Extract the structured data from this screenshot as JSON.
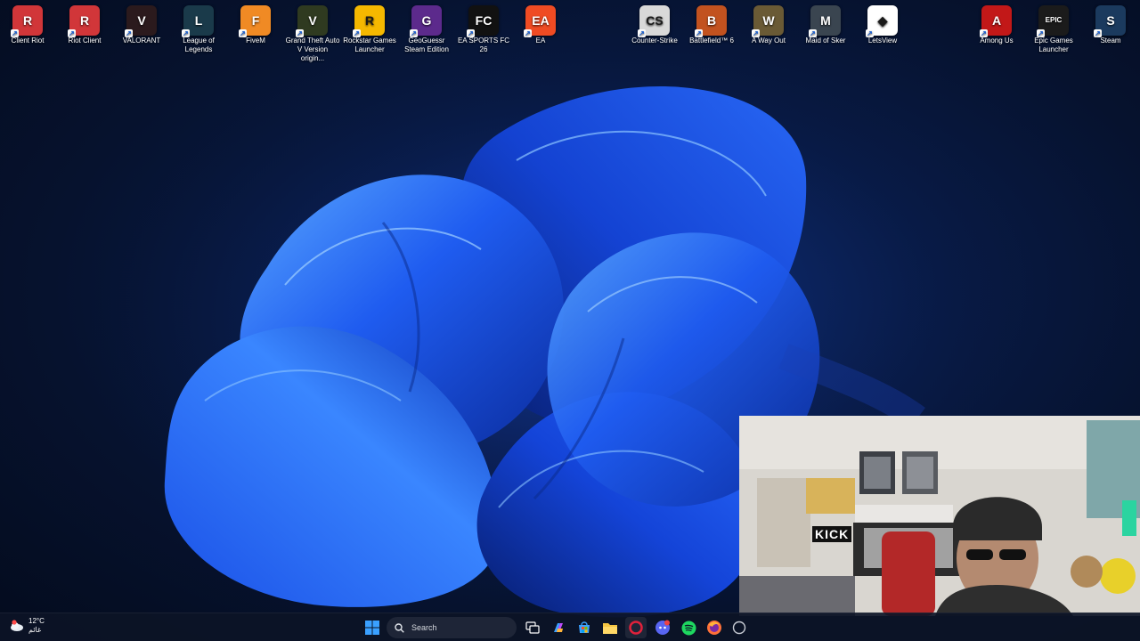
{
  "desktop": {
    "icons": [
      {
        "label": "Client Riot",
        "icon": "riot-client-icon",
        "color": "#d13639",
        "glyph": "R"
      },
      {
        "label": "Riot Client",
        "icon": "riot-client-icon",
        "color": "#d13639",
        "glyph": "R"
      },
      {
        "label": "VALORANT",
        "icon": "valorant-icon",
        "color": "#2b1a1d",
        "glyph": "V"
      },
      {
        "label": "League of Legends",
        "icon": "league-of-legends-icon",
        "color": "#1a3a4a",
        "glyph": "L"
      },
      {
        "label": "FiveM",
        "icon": "fivem-icon",
        "color": "#f08a24",
        "glyph": "F"
      },
      {
        "label": "Grand Theft Auto V Version origin...",
        "icon": "gta-v-icon",
        "color": "#2f3a20",
        "glyph": "V"
      },
      {
        "label": "Rockstar Games Launcher",
        "icon": "rockstar-icon",
        "color": "#f5b800",
        "glyph": "R"
      },
      {
        "label": "GeoGuessr Steam Edition",
        "icon": "geoguessr-icon",
        "color": "#5c2a8c",
        "glyph": "G"
      },
      {
        "label": "EA SPORTS FC 26",
        "icon": "ea-fc26-icon",
        "color": "#111111",
        "glyph": "FC"
      },
      {
        "label": "EA",
        "icon": "ea-icon",
        "color": "#ef4b23",
        "glyph": "EA"
      },
      {
        "label": "Counter-Strike",
        "icon": "counter-strike-icon",
        "color": "#d9d9d9",
        "glyph": "CS"
      },
      {
        "label": "Battlefield™ 6",
        "icon": "battlefield-icon",
        "color": "#c2521f",
        "glyph": "B"
      },
      {
        "label": "A Way Out",
        "icon": "a-way-out-icon",
        "color": "#6a5a35",
        "glyph": "W"
      },
      {
        "label": "Maid of Sker",
        "icon": "maid-of-sker-icon",
        "color": "#3a4550",
        "glyph": "M"
      },
      {
        "label": "LetsView",
        "icon": "letsview-icon",
        "color": "#ffffff",
        "glyph": "◆"
      },
      {
        "label": "Among Us",
        "icon": "among-us-icon",
        "color": "#c21818",
        "glyph": "A"
      },
      {
        "label": "Epic Games Launcher",
        "icon": "epic-games-icon",
        "color": "#1b1b1b",
        "glyph": "EPIC"
      },
      {
        "label": "Steam",
        "icon": "steam-icon",
        "color": "#1b3a5e",
        "glyph": "S"
      }
    ]
  },
  "webcam": {
    "sign_text": "KICK"
  },
  "taskbar": {
    "weather": {
      "temp": "12°C",
      "condition": "غائم",
      "icon": "weather-icon"
    },
    "search_label": "Search",
    "pinned": [
      {
        "name": "start-icon",
        "color": "#3aa0ff"
      },
      {
        "name": "task-view-icon",
        "color": "#ffffff"
      },
      {
        "name": "copilot-icon",
        "color": "#8a7bff"
      },
      {
        "name": "microsoft-store-icon",
        "color": "#3aa0ff"
      },
      {
        "name": "file-explorer-icon",
        "color": "#f5c542"
      },
      {
        "name": "opera-gx-icon",
        "color": "#e0213b"
      },
      {
        "name": "discord-icon",
        "color": "#5865f2"
      },
      {
        "name": "spotify-icon",
        "color": "#1ed760"
      },
      {
        "name": "firefox-icon",
        "color": "#ff7139"
      },
      {
        "name": "overflow-icon",
        "color": "#c8ccd4"
      }
    ]
  },
  "colors": {
    "wallpaper_bloom": "#1e5cff",
    "wallpaper_bg": "#081a45",
    "taskbar_bg": "#0c1426"
  }
}
